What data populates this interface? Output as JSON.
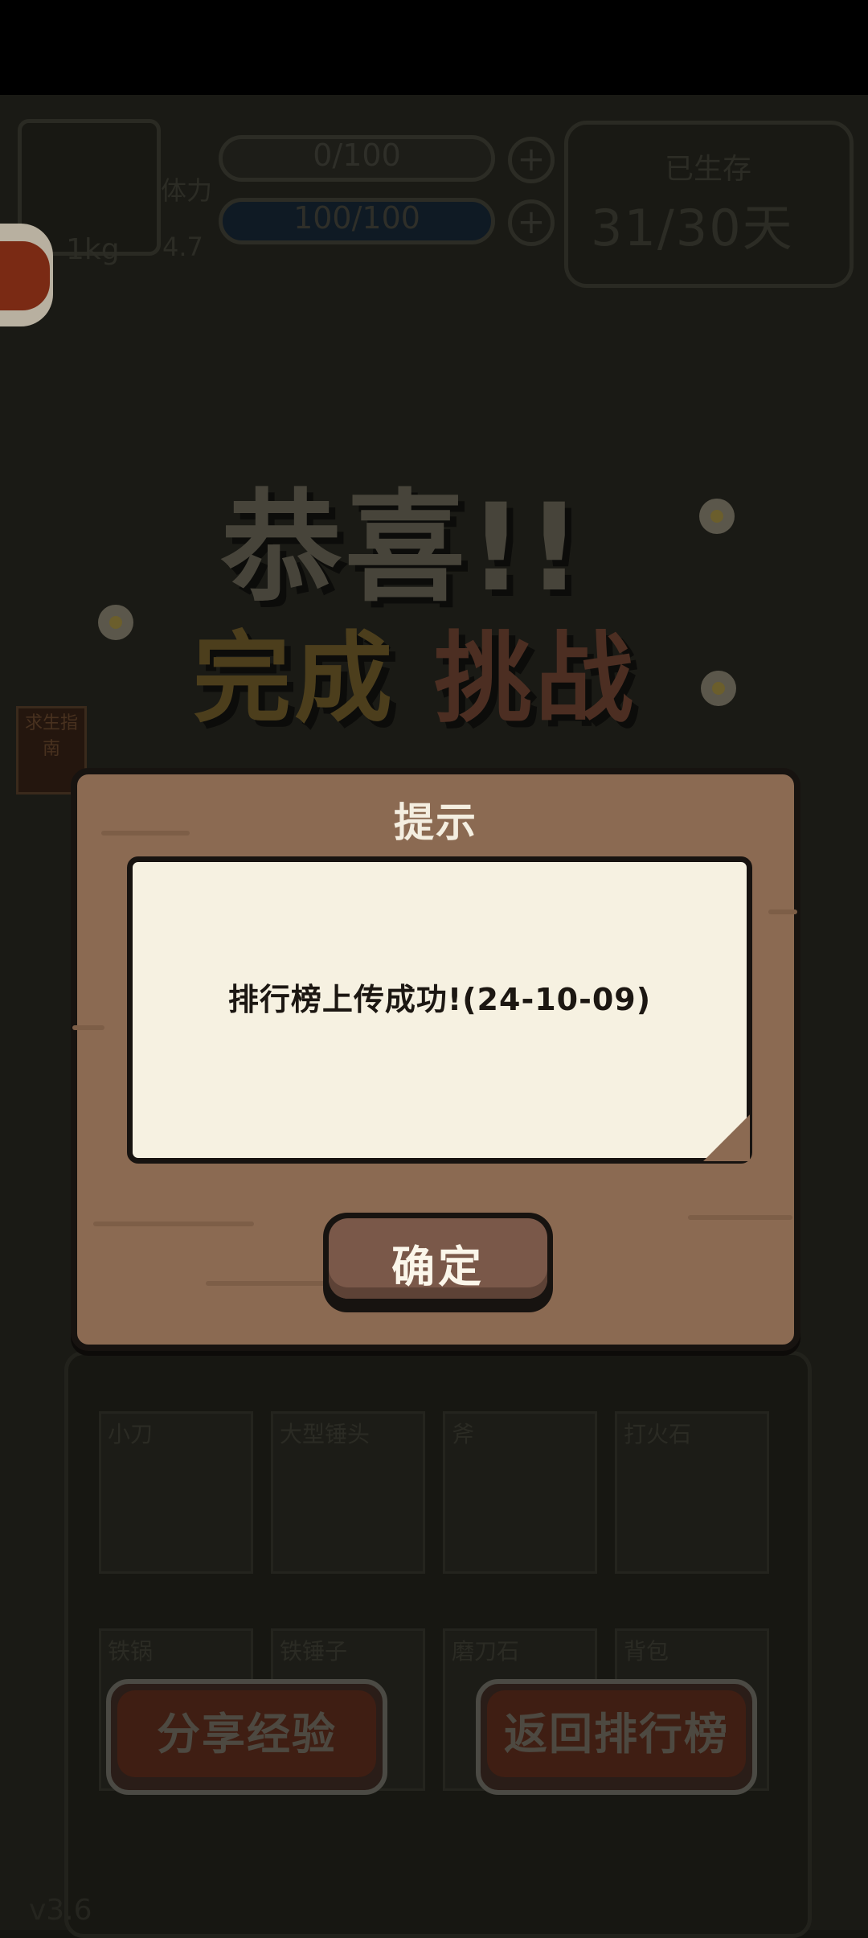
{
  "hud": {
    "weight": "1kg",
    "power_label": "体力",
    "power_value": "4.7",
    "bar1_label": "0/100",
    "bar2_label": "100/100",
    "plus_symbol": "+",
    "survived_label": "已生存",
    "days_value": "31/30天"
  },
  "celebration": {
    "line1": "恭喜!!",
    "line2_a": "完成",
    "line2_b": "挑战",
    "side_tag": "求生指南"
  },
  "equipment": {
    "slots": [
      "小刀",
      "大型锤头",
      "斧",
      "打火石",
      "铁锅",
      "铁锤子",
      "磨刀石",
      "背包"
    ]
  },
  "bottom_buttons": {
    "share": "分享经验",
    "leaderboard": "返回排行榜"
  },
  "version": "v3.6",
  "dialog": {
    "title": "提示",
    "message": "排行榜上传成功!(24-10-09)",
    "confirm": "确定"
  }
}
